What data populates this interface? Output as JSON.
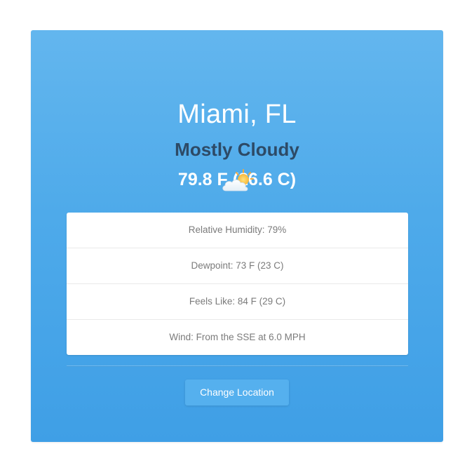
{
  "weather": {
    "location": "Miami, FL",
    "condition": "Mostly Cloudy",
    "temperature": "79.8 F (26.6 C)",
    "icon": "partly-cloudy-icon"
  },
  "details": [
    {
      "text": "Relative Humidity: 79%"
    },
    {
      "text": "Dewpoint: 73 F (23 C)"
    },
    {
      "text": "Feels Like: 84 F (29 C)"
    },
    {
      "text": "Wind: From the SSE at 6.0 MPH"
    }
  ],
  "actions": {
    "change_location_label": "Change Location"
  },
  "colors": {
    "card_top": "#63b6ee",
    "card_bottom": "#3f9fe6",
    "condition_text": "#2d4a66",
    "detail_text": "#7b7b7b",
    "button_bg": "#55b0ee"
  }
}
